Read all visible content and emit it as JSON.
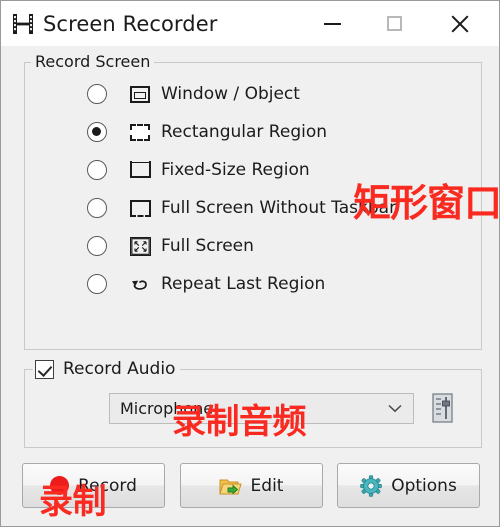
{
  "window": {
    "title": "Screen Recorder",
    "icon": "film-strip-icon",
    "controls": {
      "minimize": "—",
      "maximize": "□",
      "close": "×"
    }
  },
  "record_screen_group": {
    "title": "Record Screen",
    "options": [
      {
        "label": "Window / Object",
        "icon": "window-object-icon",
        "selected": false
      },
      {
        "label": "Rectangular Region",
        "icon": "rectangular-region-icon",
        "selected": true
      },
      {
        "label": "Fixed-Size Region",
        "icon": "fixed-size-region-icon",
        "selected": false
      },
      {
        "label": "Full Screen Without Taskbar",
        "icon": "full-screen-no-taskbar-icon",
        "selected": false
      },
      {
        "label": "Full Screen",
        "icon": "full-screen-icon",
        "selected": false
      },
      {
        "label": "Repeat Last Region",
        "icon": "repeat-last-region-icon",
        "selected": false
      }
    ]
  },
  "record_audio_group": {
    "checkbox_label": "Record Audio",
    "checked": true,
    "source_value": "Microphone",
    "source_chevron_icon": "chevron-down-icon",
    "mixer_button_icon": "audio-mixer-icon"
  },
  "actions": [
    {
      "label": "Record",
      "icon": "red-record-dot-icon"
    },
    {
      "label": "Edit",
      "icon": "folder-open-icon"
    },
    {
      "label": "Options",
      "icon": "gear-icon"
    }
  ],
  "annotations": [
    {
      "text": "矩形窗口",
      "refers_to": "Rectangular Region"
    },
    {
      "text": "录制音频",
      "refers_to": "Record Audio"
    },
    {
      "text": "录制",
      "refers_to": "Record"
    }
  ],
  "colors": {
    "window_background": "#f0f0f0",
    "title_bar": "#ffffff",
    "annotation_red": "#fa2a20",
    "record_dot_red": "#ed1c1c",
    "gear_teal": "#3aa6ae",
    "folder_yellow": "#f2c24a",
    "folder_arrow_green": "#3cab3c"
  }
}
